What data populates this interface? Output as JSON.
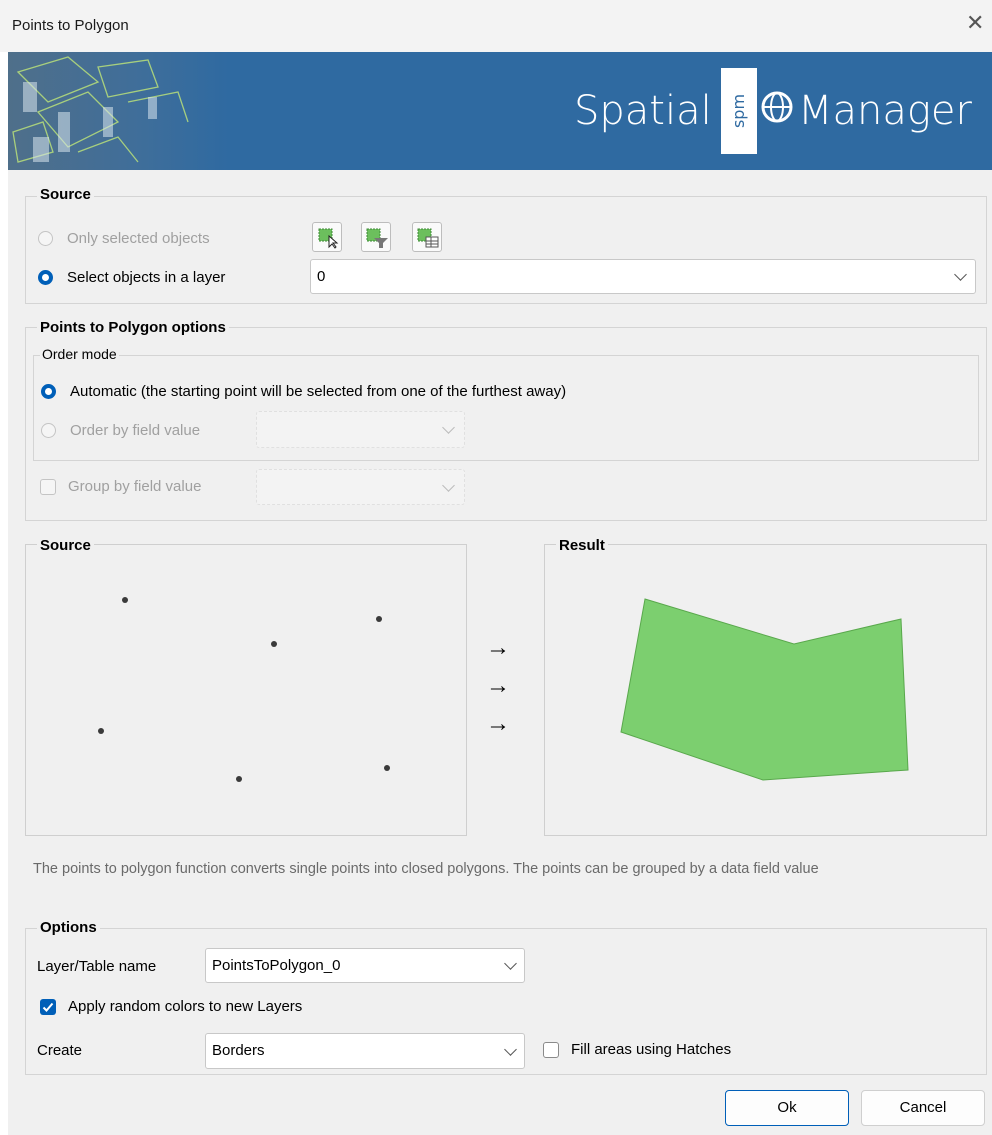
{
  "window": {
    "title": "Points to Polygon",
    "close_glyph": "✕"
  },
  "banner": {
    "logo_left": "Spatial",
    "logo_mid": "spm",
    "logo_right": "Manager",
    "bg_color": "#2f6aa1"
  },
  "source": {
    "title": "Source",
    "only_selected_label": "Only selected objects",
    "select_in_layer_label": "Select objects in a layer",
    "layer_value": "0",
    "mode": "select_in_layer"
  },
  "ptp_options": {
    "title": "Points to Polygon options",
    "order_mode_title": "Order mode",
    "automatic_label": "Automatic (the starting point will be selected from one of the furthest away)",
    "order_by_field_label": "Order by field value",
    "group_by_field_label": "Group by field value",
    "order_mode": "automatic",
    "group_by_checked": false
  },
  "preview": {
    "source_title": "Source",
    "result_title": "Result",
    "arrow_glyph": "→",
    "polygon_color": "#7ccf6f"
  },
  "description": "The points to polygon function converts single points into closed polygons. The points can be grouped by a data field value",
  "options": {
    "title": "Options",
    "layer_name_label": "Layer/Table name",
    "layer_name_value": "PointsToPolygon_0",
    "random_colors_label": "Apply random colors to new Layers",
    "random_colors_checked": true,
    "create_label": "Create",
    "create_value": "Borders",
    "fill_hatches_label": "Fill areas using Hatches",
    "fill_hatches_checked": false
  },
  "buttons": {
    "ok": "Ok",
    "cancel": "Cancel"
  },
  "colors": {
    "accent": "#005fb8",
    "panel": "#f0f0f0"
  }
}
